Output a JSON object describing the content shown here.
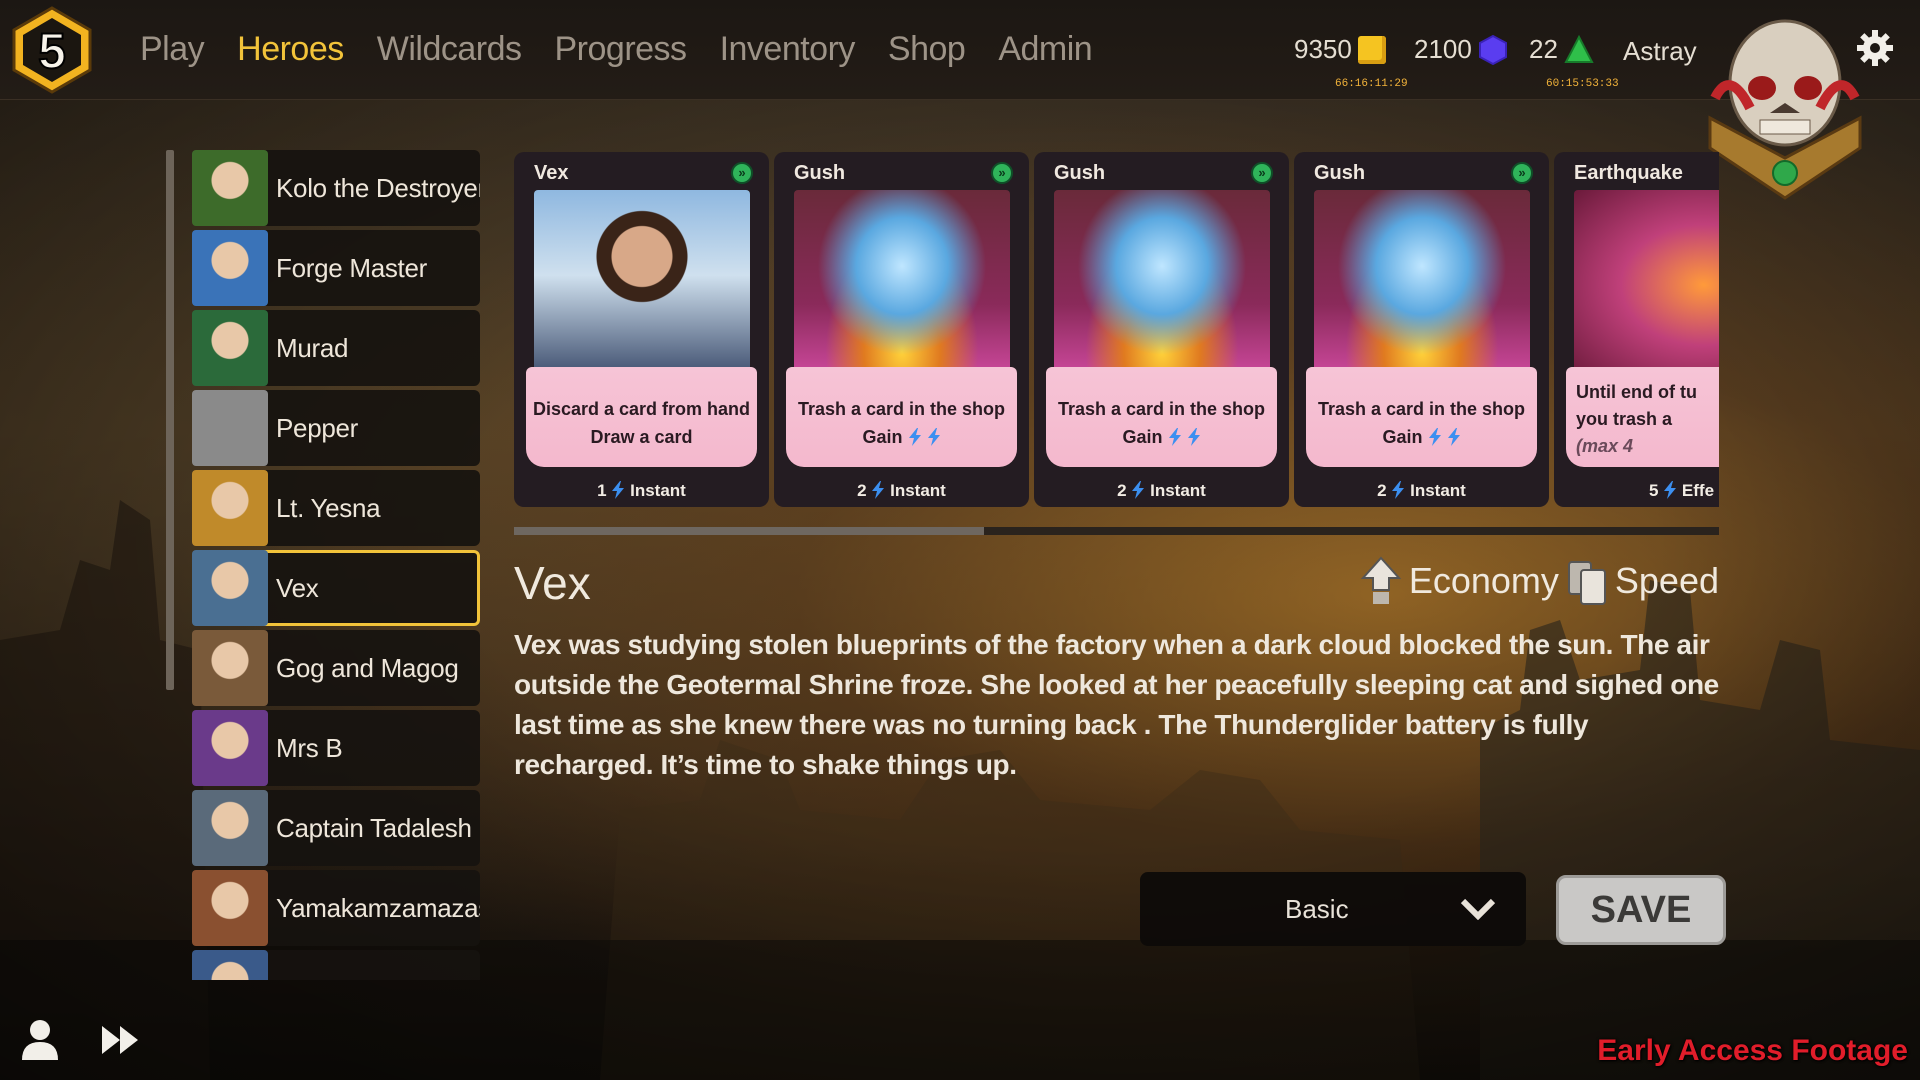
{
  "nav": {
    "items": [
      {
        "label": "Play",
        "active": false
      },
      {
        "label": "Heroes",
        "active": true
      },
      {
        "label": "Wildcards",
        "active": false
      },
      {
        "label": "Progress",
        "active": false
      },
      {
        "label": "Inventory",
        "active": false
      },
      {
        "label": "Shop",
        "active": false
      },
      {
        "label": "Admin",
        "active": false
      }
    ]
  },
  "logo": {
    "text": "5"
  },
  "currencies": {
    "gold": {
      "amount": "9350",
      "timer": "66:16:11:29",
      "color": "#f5c421",
      "icon": "gold-coin-icon"
    },
    "gems": {
      "amount": "2100",
      "color": "#5a3df0",
      "icon": "gem-hexagon-icon"
    },
    "energy": {
      "amount": "22",
      "timer": "60:15:53:33",
      "color": "#2fbf4a",
      "icon": "green-triangle-icon"
    }
  },
  "user": {
    "name": "Astray"
  },
  "heroes": [
    {
      "name": "Kolo the Destroyer",
      "color": "#3d6b2a"
    },
    {
      "name": "Forge Master",
      "color": "#3a73b8"
    },
    {
      "name": "Murad",
      "color": "#2b6a3a"
    },
    {
      "name": "Pepper",
      "color": "#8a8a8a"
    },
    {
      "name": "Lt. Yesna",
      "color": "#c08a2a"
    },
    {
      "name": "Vex",
      "color": "#4a6f92",
      "selected": true
    },
    {
      "name": "Gog and Magog",
      "color": "#7a5a3a"
    },
    {
      "name": "Mrs B",
      "color": "#6a3a8a"
    },
    {
      "name": "Captain Tadalesh",
      "color": "#5a6a7a"
    },
    {
      "name": "Yamakamzamazashi",
      "color": "#8a5030"
    },
    {
      "name": "",
      "color": "#3a5a8a"
    }
  ],
  "cards": [
    {
      "title": "Vex",
      "line1": "Discard a card from hand",
      "line2": "Draw a card",
      "bolts": 0,
      "cost": "1",
      "type": "Instant",
      "art": "hero"
    },
    {
      "title": "Gush",
      "line1": "Trash a card in the shop",
      "line2": "Gain",
      "bolts": 2,
      "cost": "2",
      "type": "Instant",
      "art": "gush"
    },
    {
      "title": "Gush",
      "line1": "Trash a card in the shop",
      "line2": "Gain",
      "bolts": 2,
      "cost": "2",
      "type": "Instant",
      "art": "gush"
    },
    {
      "title": "Gush",
      "line1": "Trash a card in the shop",
      "line2": "Gain",
      "bolts": 2,
      "cost": "2",
      "type": "Instant",
      "art": "gush"
    },
    {
      "title": "Earthquake",
      "line1": "Until end of tu",
      "line2": "you trash a",
      "line3": "(max 4",
      "bolts": 0,
      "cost": "5",
      "type": "Effe",
      "art": "quake"
    }
  ],
  "card_scroll": {
    "fraction": 0.39
  },
  "hero_detail": {
    "name": "Vex",
    "tag1": "Economy",
    "tag2": "Speed",
    "description": "Vex was studying stolen blueprints of the factory when a dark cloud blocked the sun. The air outside the Geotermal Shrine froze. She looked at her peacefully sleeping cat and sighed one last time as she knew there was no turning back . The Thunderglider battery is fully recharged. It’s time to shake things up."
  },
  "deck_select": {
    "value": "Basic"
  },
  "save_label": "SAVE",
  "watermark": "Early Access Footage"
}
